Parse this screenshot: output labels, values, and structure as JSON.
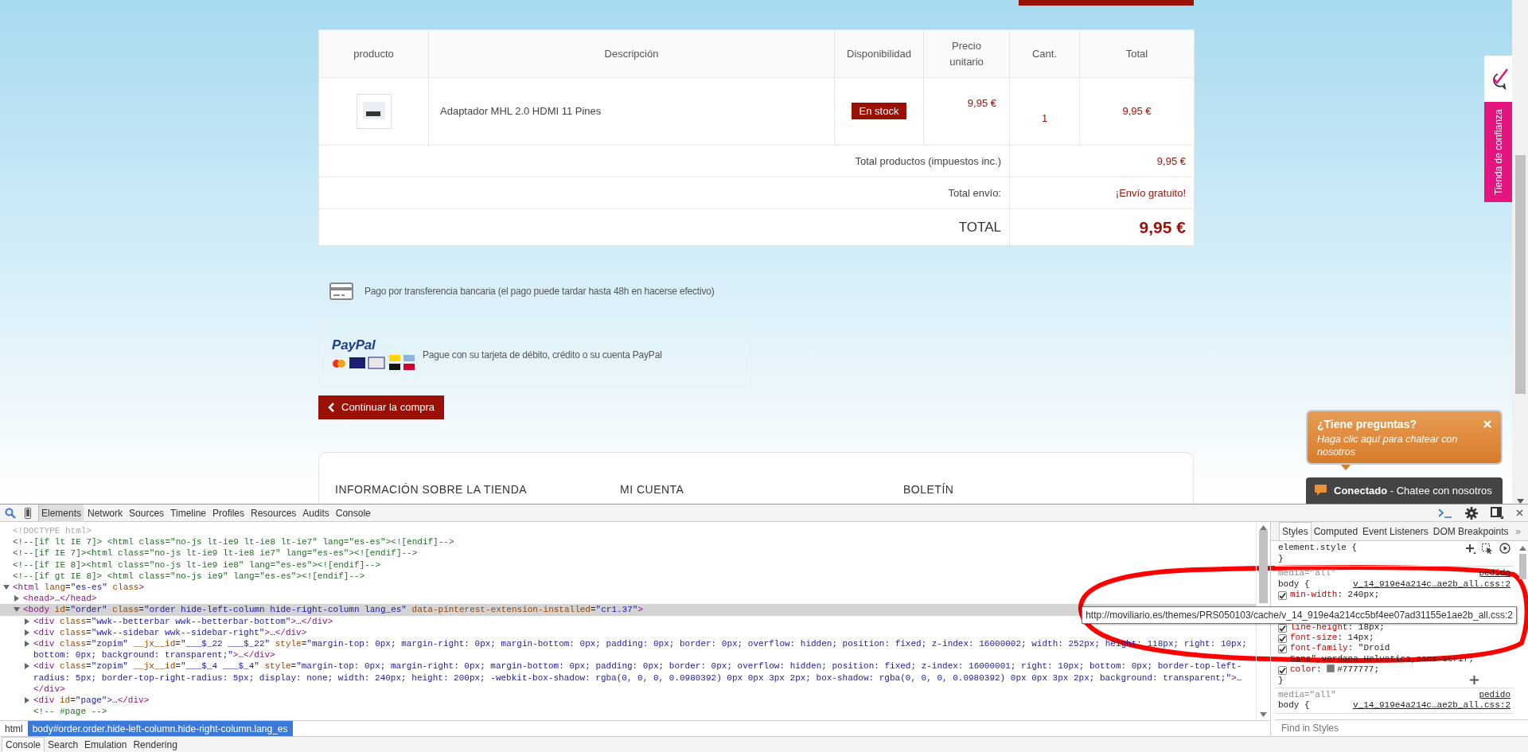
{
  "site": {
    "cart_table": {
      "columns": [
        "producto",
        "Descripción",
        "Disponibilidad",
        "Precio unitario",
        "Cant.",
        "Total"
      ],
      "rows": [
        {
          "description": "Adaptador MHL 2.0 HDMI 11 Pines",
          "availability": "En stock",
          "unit_price": "9,95 €",
          "quantity": "1",
          "total": "9,95 €"
        }
      ],
      "summary": [
        {
          "kind": "line",
          "label": "Total productos (impuestos inc.)",
          "value": "9,95 €"
        },
        {
          "kind": "line",
          "label": "Total envío:",
          "value": "¡Envío gratuito!"
        },
        {
          "kind": "grand",
          "label": "TOTAL",
          "value": "9,95 €"
        }
      ]
    },
    "payment_options": [
      {
        "kind": "transfer",
        "text": "Pago por transferencia bancaria (el pago puede tardar hasta 48h en hacerse efectivo)"
      },
      {
        "kind": "paypal",
        "logo": "PayPal",
        "text": "Pague con su tarjeta de débito, crédito o su cuenta PayPal"
      }
    ],
    "continue_button": "Continuar la compra",
    "footer_headings": [
      "INFORMACIÓN SOBRE LA TIENDA",
      "MI CUENTA",
      "BOLETÍN"
    ],
    "trust_badge": "Tienda de confianza",
    "chat": {
      "title": "¿Tiene preguntas?",
      "message": "Haga clic aquí para chatear con nosotros",
      "status": "Conectado",
      "status_text": "- Chatee con nosotros"
    }
  },
  "devtools": {
    "tabs": [
      {
        "label": "Elements",
        "selected": true
      },
      {
        "label": "Network",
        "selected": false
      },
      {
        "label": "Sources",
        "selected": false
      },
      {
        "label": "Timeline",
        "selected": false
      },
      {
        "label": "Profiles",
        "selected": false
      },
      {
        "label": "Resources",
        "selected": false
      },
      {
        "label": "Audits",
        "selected": false
      },
      {
        "label": "Console",
        "selected": false
      }
    ],
    "dom_tree": [
      {
        "kind": "doctype",
        "text": "<!DOCTYPE html>",
        "selected": false
      },
      {
        "kind": "comment",
        "text": "<!--[if lt IE 7]> <html class=\"no-js lt-ie9 lt-ie8 lt-ie7\" lang=\"es-es\"><![endif]-->",
        "selected": false
      },
      {
        "kind": "comment",
        "text": "<!--[if IE 7]><html class=\"no-js lt-ie9 lt-ie8 ie7\" lang=\"es-es\"><![endif]-->",
        "selected": false
      },
      {
        "kind": "comment",
        "text": "<!--[if IE 8]><html class=\"no-js lt-ie9 ie8\" lang=\"es-es\"><![endif]-->",
        "selected": false
      },
      {
        "kind": "comment",
        "text": "<!--[if gt IE 8]> <html class=\"no-js ie9\" lang=\"es-es\"><![endif]-->",
        "selected": false
      },
      {
        "kind": "element",
        "text": "<html lang=\"es-es\" class>",
        "expanded": true,
        "selected": false,
        "children": [
          {
            "kind": "element",
            "text": "<head>…</head>",
            "expanded": false,
            "selected": false
          },
          {
            "kind": "element",
            "text": "<body id=\"order\" class=\"order hide-left-column hide-right-column lang_es\" data-pinterest-extension-installed=\"cr1.37\">",
            "expanded": true,
            "selected": true,
            "children": [
              {
                "kind": "element",
                "text": "<div class=\"wwk--betterbar wwk--betterbar-bottom\">…</div>",
                "expanded": false,
                "selected": false
              },
              {
                "kind": "element",
                "text": "<div class=\"wwk--sidebar wwk--sidebar-right\">…</div>",
                "expanded": false,
                "selected": false
              },
              {
                "kind": "element",
                "text": "<div class=\"zopim\" __jx__id=\"___$_22 ___$_22\" style=\"margin-top: 0px; margin-right: 0px; margin-bottom: 0px; padding: 0px; border: 0px; overflow: hidden; position: fixed; z-index: 16000002; width: 252px; height: 118px; right: 10px; bottom: 0px; background: transparent;\">…</div>",
                "expanded": false,
                "selected": false
              },
              {
                "kind": "element",
                "text": "<div class=\"zopim\" __jx__id=\"___$_4 ___$_4\" style=\"margin-top: 0px; margin-right: 0px; margin-bottom: 0px; padding: 0px; border: 0px; overflow: hidden; position: fixed; z-index: 16000001; right: 10px; bottom: 0px; border-top-left-radius: 5px; border-top-right-radius: 5px; display: none; width: 240px; height: 200px; -webkit-box-shadow: rgba(0, 0, 0, 0.0980392) 0px 0px 3px 2px; box-shadow: rgba(0, 0, 0, 0.0980392) 0px 0px 3px 2px; background: transparent;\">…</div>",
                "expanded": false,
                "selected": false
              },
              {
                "kind": "element",
                "text": "<div id=\"page\">…</div>",
                "expanded": false,
                "selected": false
              },
              {
                "kind": "comment",
                "text": "<!-- #page -->",
                "selected": false
              }
            ]
          }
        ]
      }
    ],
    "breadcrumbs": [
      {
        "label": "html",
        "selected": false
      },
      {
        "label": "body#order.order.hide-left-column.hide-right-column.lang_es",
        "selected": true
      }
    ],
    "sidebar_tabs": [
      {
        "label": "Styles",
        "selected": true
      },
      {
        "label": "Computed",
        "selected": false
      },
      {
        "label": "Event Listeners",
        "selected": false
      },
      {
        "label": "DOM Breakpoints",
        "selected": false
      }
    ],
    "sidebar_more": "»",
    "style_rules": [
      {
        "kind": "inline",
        "selector": "element.style {",
        "close": "}"
      },
      {
        "kind": "rule",
        "media": "media=\"all\"",
        "origin": "pedido",
        "selector": "body {",
        "source": "v_14_919e4a214c…ae2b_all.css:2",
        "close": "}",
        "properties": [
          {
            "name": "min-width",
            "value": ": 240px;",
            "checked": true
          },
          {
            "name": "line-height",
            "value": ": 18px;",
            "checked": true
          },
          {
            "name": "font-size",
            "value": ": 14px;",
            "checked": true
          },
          {
            "name": "font-family",
            "value": ": \"Droid Sans\",verdana,Helvetica,sans-serif;",
            "checked": true
          },
          {
            "name": "color",
            "value": ": #777777;",
            "checked": true
          }
        ]
      },
      {
        "kind": "rule",
        "media": "media=\"all\"",
        "origin": "pedido",
        "selector": "body {",
        "source": "v_14_919e4a214c…ae2b_all.css:2"
      }
    ],
    "find_placeholder": "Find in Styles",
    "tooltip": "http://moviliario.es/themes/PRS050103/cache/v_14_919e4a214cc5bf4ee07ad31155e1ae2b_all.css:2",
    "drawer_tabs": [
      {
        "label": "Console",
        "selected": true
      },
      {
        "label": "Search",
        "selected": false
      },
      {
        "label": "Emulation",
        "selected": false
      },
      {
        "label": "Rendering",
        "selected": false
      }
    ]
  }
}
